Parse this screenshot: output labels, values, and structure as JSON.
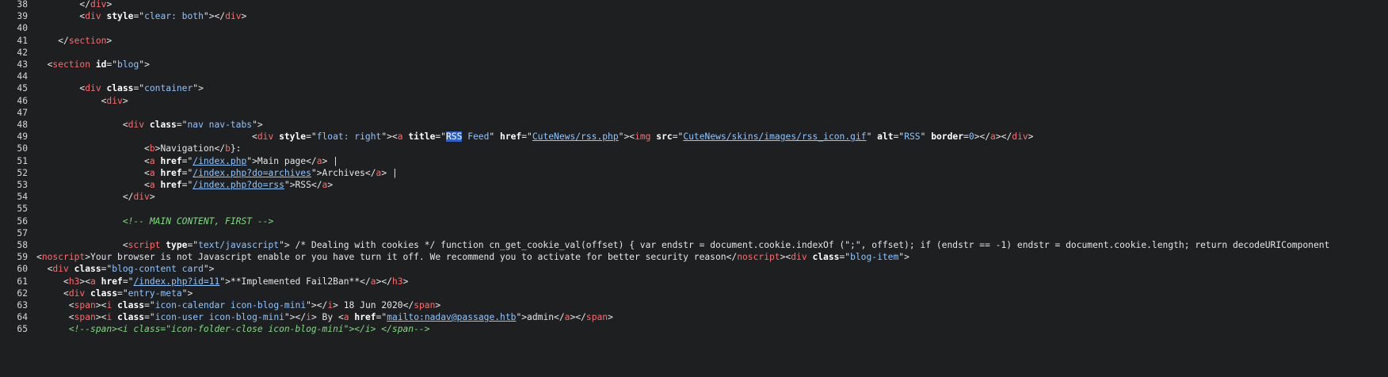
{
  "viewer": {
    "lines": [
      {
        "n": "38",
        "parts": [
          [
            "p",
            "        "
          ],
          [
            "p",
            "</"
          ],
          [
            "t",
            "div"
          ],
          [
            "p",
            ">"
          ]
        ]
      },
      {
        "n": "39",
        "parts": [
          [
            "p",
            "        <"
          ],
          [
            "t",
            "div"
          ],
          [
            "p",
            " "
          ],
          [
            "a",
            "style"
          ],
          [
            "p",
            "=\""
          ],
          [
            "s",
            "clear: both"
          ],
          [
            "p",
            "\"></"
          ],
          [
            "t",
            "div"
          ],
          [
            "p",
            ">"
          ]
        ]
      },
      {
        "n": "40",
        "parts": []
      },
      {
        "n": "41",
        "parts": [
          [
            "p",
            "    </"
          ],
          [
            "t",
            "section"
          ],
          [
            "p",
            ">"
          ]
        ]
      },
      {
        "n": "42",
        "parts": []
      },
      {
        "n": "43",
        "parts": [
          [
            "p",
            "  <"
          ],
          [
            "t",
            "section"
          ],
          [
            "p",
            " "
          ],
          [
            "a",
            "id"
          ],
          [
            "p",
            "=\""
          ],
          [
            "s",
            "blog"
          ],
          [
            "p",
            "\">"
          ]
        ]
      },
      {
        "n": "44",
        "parts": []
      },
      {
        "n": "45",
        "parts": [
          [
            "p",
            "        <"
          ],
          [
            "t",
            "div"
          ],
          [
            "p",
            " "
          ],
          [
            "a",
            "class"
          ],
          [
            "p",
            "=\""
          ],
          [
            "s",
            "container"
          ],
          [
            "p",
            "\">"
          ]
        ]
      },
      {
        "n": "46",
        "parts": [
          [
            "p",
            "            <"
          ],
          [
            "t",
            "div"
          ],
          [
            "p",
            ">"
          ]
        ]
      },
      {
        "n": "47",
        "parts": []
      },
      {
        "n": "48",
        "parts": [
          [
            "p",
            "                <"
          ],
          [
            "t",
            "div"
          ],
          [
            "p",
            " "
          ],
          [
            "a",
            "class"
          ],
          [
            "p",
            "=\""
          ],
          [
            "s",
            "nav nav-tabs"
          ],
          [
            "p",
            "\">"
          ]
        ]
      },
      {
        "n": "49",
        "parts": [
          [
            "p",
            "                                        <"
          ],
          [
            "t",
            "div"
          ],
          [
            "p",
            " "
          ],
          [
            "a",
            "style"
          ],
          [
            "p",
            "=\""
          ],
          [
            "s",
            "float: right"
          ],
          [
            "p",
            "\"><"
          ],
          [
            "t",
            "a"
          ],
          [
            "p",
            " "
          ],
          [
            "a",
            "title"
          ],
          [
            "p",
            "=\""
          ],
          [
            "h",
            "RSS"
          ],
          [
            "s",
            " Feed"
          ],
          [
            "p",
            "\" "
          ],
          [
            "a",
            "href"
          ],
          [
            "p",
            "=\""
          ],
          [
            "l",
            "CuteNews/rss.php"
          ],
          [
            "p",
            "\"><"
          ],
          [
            "t",
            "img"
          ],
          [
            "p",
            " "
          ],
          [
            "a",
            "src"
          ],
          [
            "p",
            "=\""
          ],
          [
            "l",
            "CuteNews/skins/images/rss_icon.gif"
          ],
          [
            "p",
            "\" "
          ],
          [
            "a",
            "alt"
          ],
          [
            "p",
            "=\""
          ],
          [
            "s",
            "RSS"
          ],
          [
            "p",
            "\" "
          ],
          [
            "a",
            "border"
          ],
          [
            "p",
            "="
          ],
          [
            "s",
            "0"
          ],
          [
            "p",
            "></"
          ],
          [
            "t",
            "a"
          ],
          [
            "p",
            "></"
          ],
          [
            "t",
            "div"
          ],
          [
            "p",
            ">"
          ]
        ]
      },
      {
        "n": "50",
        "parts": [
          [
            "p",
            "                    <"
          ],
          [
            "t",
            "b"
          ],
          [
            "p",
            ">Navigation</"
          ],
          [
            "t",
            "b"
          ],
          [
            "p",
            "}:"
          ]
        ]
      },
      {
        "n": "51",
        "parts": [
          [
            "p",
            "                    <"
          ],
          [
            "t",
            "a"
          ],
          [
            "p",
            " "
          ],
          [
            "a",
            "href"
          ],
          [
            "p",
            "=\""
          ],
          [
            "l",
            "/index.php"
          ],
          [
            "p",
            "\">Main page</"
          ],
          [
            "t",
            "a"
          ],
          [
            "p",
            "> |"
          ]
        ]
      },
      {
        "n": "52",
        "parts": [
          [
            "p",
            "                    <"
          ],
          [
            "t",
            "a"
          ],
          [
            "p",
            " "
          ],
          [
            "a",
            "href"
          ],
          [
            "p",
            "=\""
          ],
          [
            "l",
            "/index.php?do=archives"
          ],
          [
            "p",
            "\">Archives</"
          ],
          [
            "t",
            "a"
          ],
          [
            "p",
            "> |"
          ]
        ]
      },
      {
        "n": "53",
        "parts": [
          [
            "p",
            "                    <"
          ],
          [
            "t",
            "a"
          ],
          [
            "p",
            " "
          ],
          [
            "a",
            "href"
          ],
          [
            "p",
            "=\""
          ],
          [
            "l",
            "/index.php?do=rss"
          ],
          [
            "p",
            "\">RSS</"
          ],
          [
            "t",
            "a"
          ],
          [
            "p",
            ">"
          ]
        ]
      },
      {
        "n": "54",
        "parts": [
          [
            "p",
            "                </"
          ],
          [
            "t",
            "div"
          ],
          [
            "p",
            ">"
          ]
        ]
      },
      {
        "n": "55",
        "parts": []
      },
      {
        "n": "56",
        "parts": [
          [
            "p",
            "                "
          ],
          [
            "c",
            "<!-- MAIN CONTENT, FIRST -->"
          ]
        ]
      },
      {
        "n": "57",
        "parts": []
      },
      {
        "n": "58",
        "parts": [
          [
            "p",
            "                <"
          ],
          [
            "t",
            "script"
          ],
          [
            "p",
            " "
          ],
          [
            "a",
            "type"
          ],
          [
            "p",
            "=\""
          ],
          [
            "s",
            "text/javascript"
          ],
          [
            "p",
            "\"> /* Dealing with cookies */ function cn_get_cookie_val(offset) { var endstr = document.cookie.indexOf (\";\", offset); if (endstr == -1) endstr = document.cookie.length; return decodeURIComponent"
          ]
        ]
      },
      {
        "n": "59",
        "parts": [
          [
            "p",
            "<"
          ],
          [
            "t",
            "noscript"
          ],
          [
            "p",
            ">Your browser is not Javascript enable or you have turn it off. We recommend you to activate for better security reason</"
          ],
          [
            "t",
            "noscript"
          ],
          [
            "p",
            "><"
          ],
          [
            "t",
            "div"
          ],
          [
            "p",
            " "
          ],
          [
            "a",
            "class"
          ],
          [
            "p",
            "=\""
          ],
          [
            "s",
            "blog-item"
          ],
          [
            "p",
            "\">"
          ]
        ]
      },
      {
        "n": "60",
        "parts": [
          [
            "p",
            "  <"
          ],
          [
            "t",
            "div"
          ],
          [
            "p",
            " "
          ],
          [
            "a",
            "class"
          ],
          [
            "p",
            "=\""
          ],
          [
            "s",
            "blog-content card"
          ],
          [
            "p",
            "\">"
          ]
        ]
      },
      {
        "n": "61",
        "parts": [
          [
            "p",
            "     <"
          ],
          [
            "t",
            "h3"
          ],
          [
            "p",
            "><"
          ],
          [
            "t",
            "a"
          ],
          [
            "p",
            " "
          ],
          [
            "a",
            "href"
          ],
          [
            "p",
            "=\""
          ],
          [
            "l",
            "/index.php?id=11"
          ],
          [
            "p",
            "\">**Implemented Fail2Ban**</"
          ],
          [
            "t",
            "a"
          ],
          [
            "p",
            "></"
          ],
          [
            "t",
            "h3"
          ],
          [
            "p",
            ">"
          ]
        ]
      },
      {
        "n": "62",
        "parts": [
          [
            "p",
            "     <"
          ],
          [
            "t",
            "div"
          ],
          [
            "p",
            " "
          ],
          [
            "a",
            "class"
          ],
          [
            "p",
            "=\""
          ],
          [
            "s",
            "entry-meta"
          ],
          [
            "p",
            "\">"
          ]
        ]
      },
      {
        "n": "63",
        "parts": [
          [
            "p",
            "      <"
          ],
          [
            "t",
            "span"
          ],
          [
            "p",
            "><"
          ],
          [
            "t",
            "i"
          ],
          [
            "p",
            " "
          ],
          [
            "a",
            "class"
          ],
          [
            "p",
            "=\""
          ],
          [
            "s",
            "icon-calendar icon-blog-mini"
          ],
          [
            "p",
            "\"></"
          ],
          [
            "t",
            "i"
          ],
          [
            "p",
            "> 18 Jun 2020</"
          ],
          [
            "t",
            "span"
          ],
          [
            "p",
            ">"
          ]
        ]
      },
      {
        "n": "64",
        "parts": [
          [
            "p",
            "      <"
          ],
          [
            "t",
            "span"
          ],
          [
            "p",
            "><"
          ],
          [
            "t",
            "i"
          ],
          [
            "p",
            " "
          ],
          [
            "a",
            "class"
          ],
          [
            "p",
            "=\""
          ],
          [
            "s",
            "icon-user icon-blog-mini"
          ],
          [
            "p",
            "\"></"
          ],
          [
            "t",
            "i"
          ],
          [
            "p",
            "> By <"
          ],
          [
            "t",
            "a"
          ],
          [
            "p",
            " "
          ],
          [
            "a",
            "href"
          ],
          [
            "p",
            "=\""
          ],
          [
            "l",
            "mailto:nadav@passage.htb"
          ],
          [
            "p",
            "\">admin</"
          ],
          [
            "t",
            "a"
          ],
          [
            "p",
            "></"
          ],
          [
            "t",
            "span"
          ],
          [
            "p",
            ">"
          ]
        ]
      },
      {
        "n": "65",
        "parts": [
          [
            "p",
            "      "
          ],
          [
            "c",
            "<!--span><i class=\"icon-folder-close icon-blog-mini\"></i> </span-->"
          ]
        ]
      }
    ]
  }
}
